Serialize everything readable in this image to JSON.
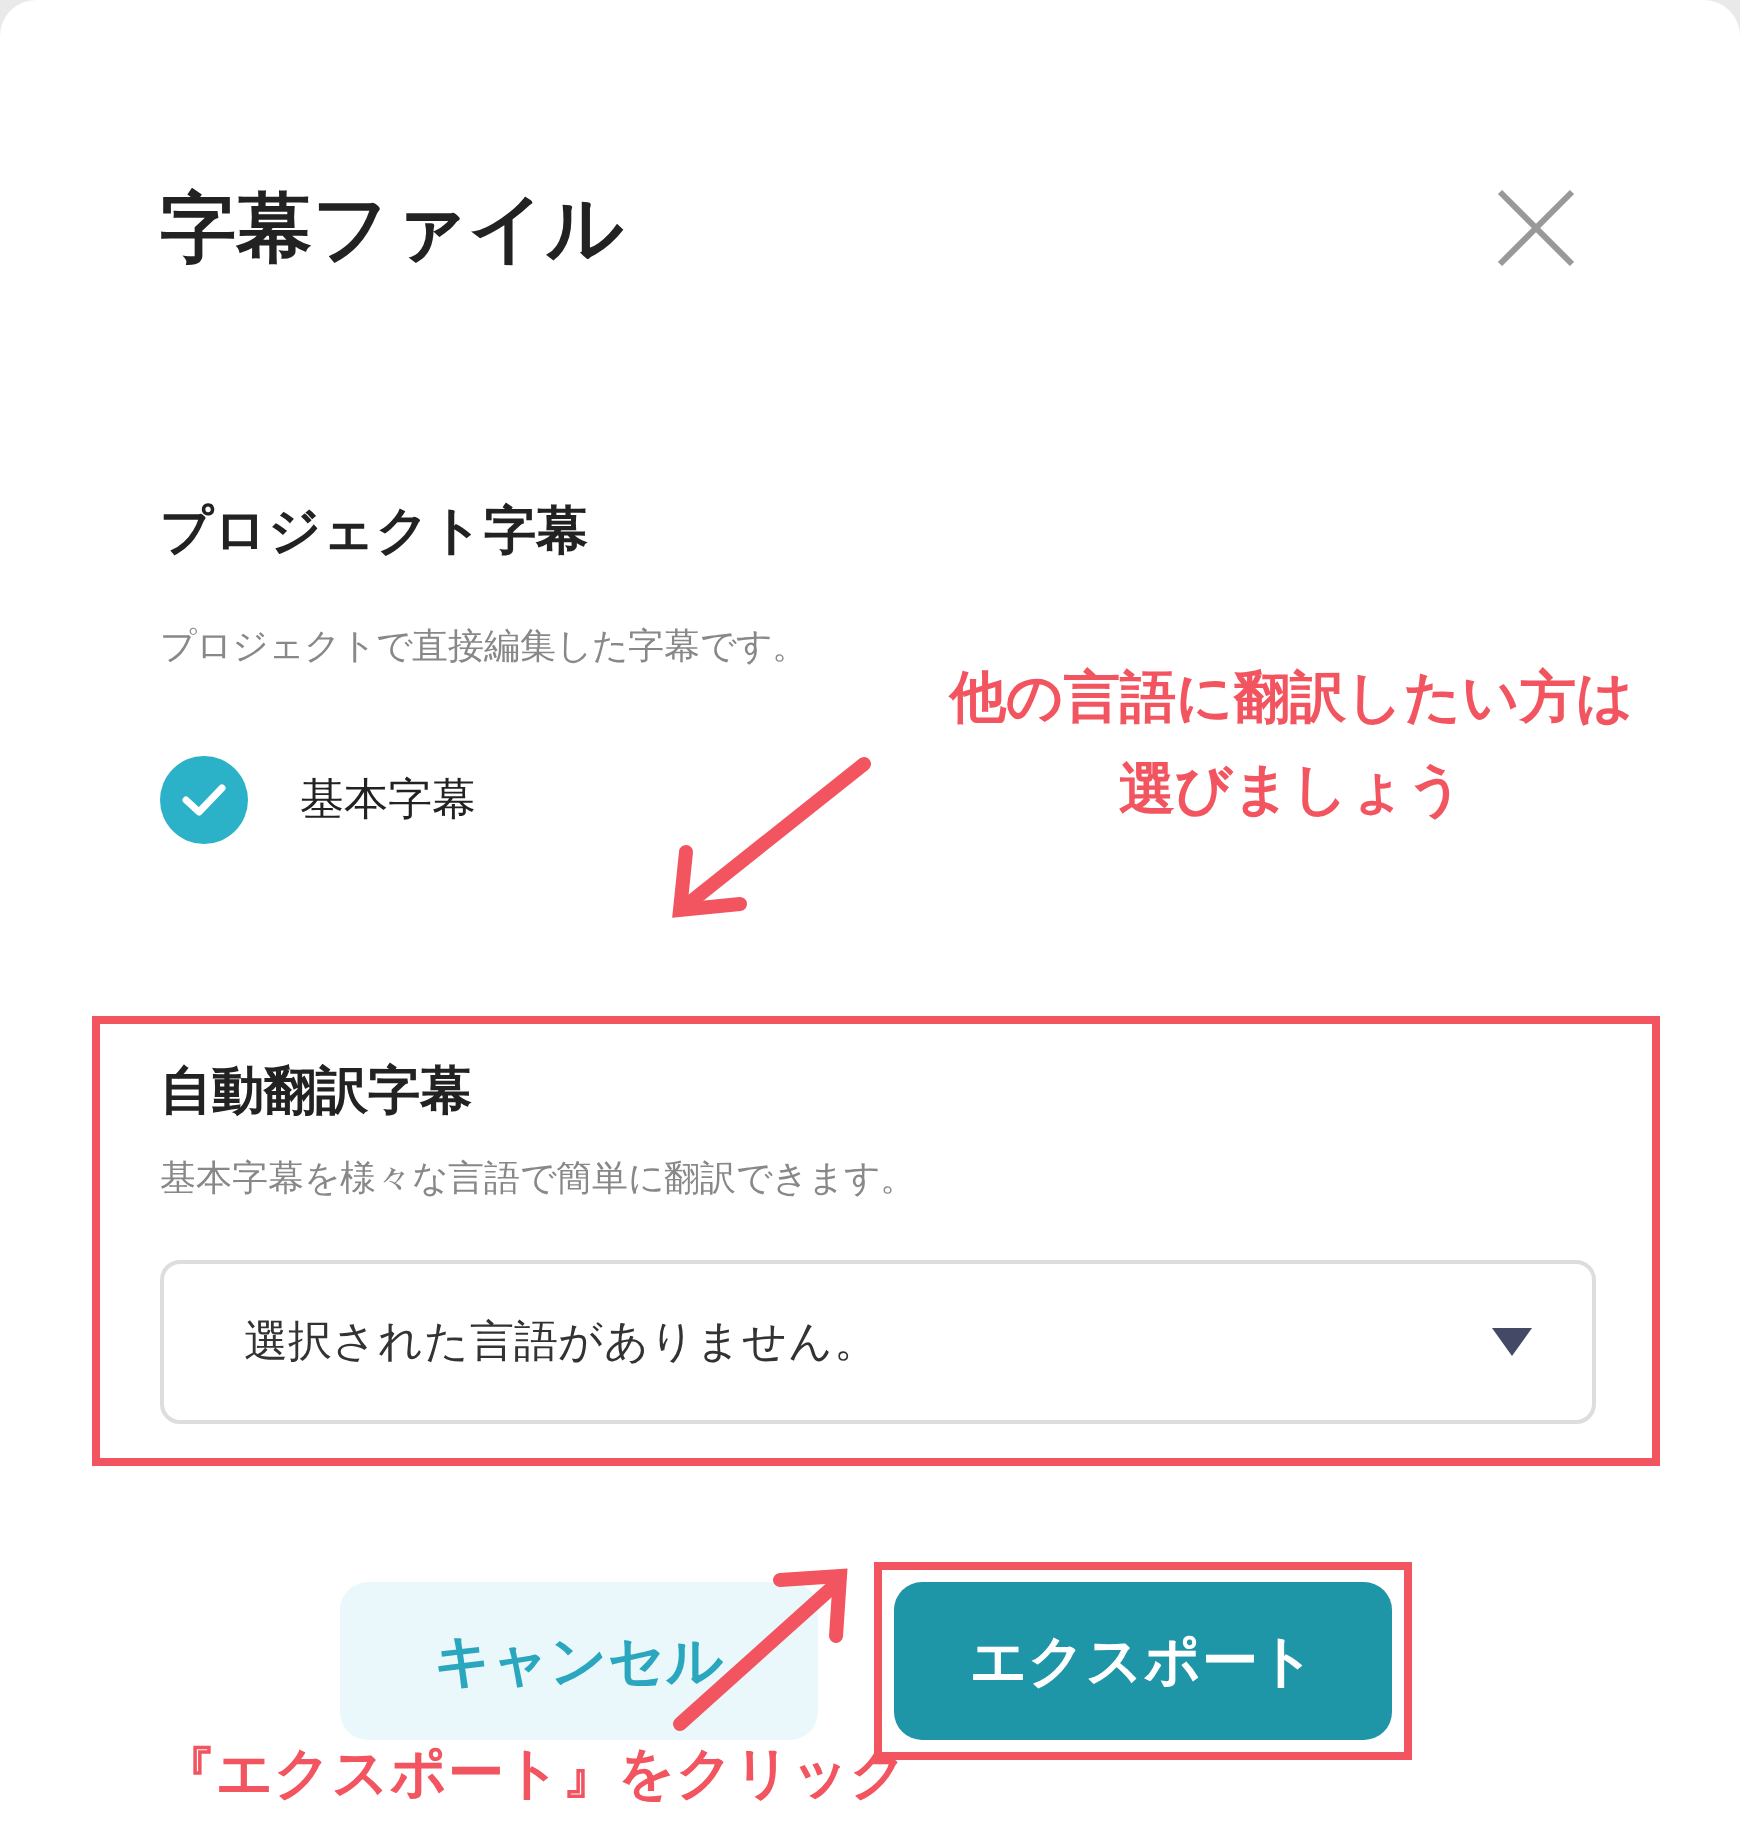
{
  "dialog": {
    "title": "字幕ファイル"
  },
  "project_subtitles": {
    "heading": "プロジェクト字幕",
    "description": "プロジェクトで直接編集した字幕です。",
    "options": [
      {
        "label": "基本字幕",
        "checked": true
      }
    ]
  },
  "auto_translate": {
    "heading": "自動翻訳字幕",
    "description": "基本字幕を様々な言語で簡単に翻訳できます。",
    "highlighted": true,
    "dropdown": {
      "placeholder": "選択された言語がありません。"
    }
  },
  "buttons": [
    {
      "label": "キャンセル",
      "kind": "secondary",
      "highlighted": false
    },
    {
      "label": "エクスポート",
      "kind": "primary",
      "highlighted": true
    }
  ],
  "annotations": [
    {
      "lines": [
        "他の言語に翻訳したい方は",
        "選びましょう"
      ]
    },
    {
      "lines": [
        "『エクスポート』をクリック"
      ]
    }
  ]
}
